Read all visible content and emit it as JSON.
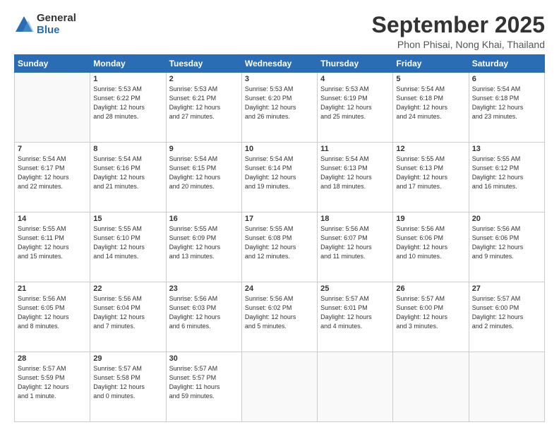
{
  "logo": {
    "text_general": "General",
    "text_blue": "Blue"
  },
  "header": {
    "month": "September 2025",
    "location": "Phon Phisai, Nong Khai, Thailand"
  },
  "days_of_week": [
    "Sunday",
    "Monday",
    "Tuesday",
    "Wednesday",
    "Thursday",
    "Friday",
    "Saturday"
  ],
  "weeks": [
    [
      {
        "num": "",
        "info": ""
      },
      {
        "num": "1",
        "info": "Sunrise: 5:53 AM\nSunset: 6:22 PM\nDaylight: 12 hours\nand 28 minutes."
      },
      {
        "num": "2",
        "info": "Sunrise: 5:53 AM\nSunset: 6:21 PM\nDaylight: 12 hours\nand 27 minutes."
      },
      {
        "num": "3",
        "info": "Sunrise: 5:53 AM\nSunset: 6:20 PM\nDaylight: 12 hours\nand 26 minutes."
      },
      {
        "num": "4",
        "info": "Sunrise: 5:53 AM\nSunset: 6:19 PM\nDaylight: 12 hours\nand 25 minutes."
      },
      {
        "num": "5",
        "info": "Sunrise: 5:54 AM\nSunset: 6:18 PM\nDaylight: 12 hours\nand 24 minutes."
      },
      {
        "num": "6",
        "info": "Sunrise: 5:54 AM\nSunset: 6:18 PM\nDaylight: 12 hours\nand 23 minutes."
      }
    ],
    [
      {
        "num": "7",
        "info": "Sunrise: 5:54 AM\nSunset: 6:17 PM\nDaylight: 12 hours\nand 22 minutes."
      },
      {
        "num": "8",
        "info": "Sunrise: 5:54 AM\nSunset: 6:16 PM\nDaylight: 12 hours\nand 21 minutes."
      },
      {
        "num": "9",
        "info": "Sunrise: 5:54 AM\nSunset: 6:15 PM\nDaylight: 12 hours\nand 20 minutes."
      },
      {
        "num": "10",
        "info": "Sunrise: 5:54 AM\nSunset: 6:14 PM\nDaylight: 12 hours\nand 19 minutes."
      },
      {
        "num": "11",
        "info": "Sunrise: 5:54 AM\nSunset: 6:13 PM\nDaylight: 12 hours\nand 18 minutes."
      },
      {
        "num": "12",
        "info": "Sunrise: 5:55 AM\nSunset: 6:13 PM\nDaylight: 12 hours\nand 17 minutes."
      },
      {
        "num": "13",
        "info": "Sunrise: 5:55 AM\nSunset: 6:12 PM\nDaylight: 12 hours\nand 16 minutes."
      }
    ],
    [
      {
        "num": "14",
        "info": "Sunrise: 5:55 AM\nSunset: 6:11 PM\nDaylight: 12 hours\nand 15 minutes."
      },
      {
        "num": "15",
        "info": "Sunrise: 5:55 AM\nSunset: 6:10 PM\nDaylight: 12 hours\nand 14 minutes."
      },
      {
        "num": "16",
        "info": "Sunrise: 5:55 AM\nSunset: 6:09 PM\nDaylight: 12 hours\nand 13 minutes."
      },
      {
        "num": "17",
        "info": "Sunrise: 5:55 AM\nSunset: 6:08 PM\nDaylight: 12 hours\nand 12 minutes."
      },
      {
        "num": "18",
        "info": "Sunrise: 5:56 AM\nSunset: 6:07 PM\nDaylight: 12 hours\nand 11 minutes."
      },
      {
        "num": "19",
        "info": "Sunrise: 5:56 AM\nSunset: 6:06 PM\nDaylight: 12 hours\nand 10 minutes."
      },
      {
        "num": "20",
        "info": "Sunrise: 5:56 AM\nSunset: 6:06 PM\nDaylight: 12 hours\nand 9 minutes."
      }
    ],
    [
      {
        "num": "21",
        "info": "Sunrise: 5:56 AM\nSunset: 6:05 PM\nDaylight: 12 hours\nand 8 minutes."
      },
      {
        "num": "22",
        "info": "Sunrise: 5:56 AM\nSunset: 6:04 PM\nDaylight: 12 hours\nand 7 minutes."
      },
      {
        "num": "23",
        "info": "Sunrise: 5:56 AM\nSunset: 6:03 PM\nDaylight: 12 hours\nand 6 minutes."
      },
      {
        "num": "24",
        "info": "Sunrise: 5:56 AM\nSunset: 6:02 PM\nDaylight: 12 hours\nand 5 minutes."
      },
      {
        "num": "25",
        "info": "Sunrise: 5:57 AM\nSunset: 6:01 PM\nDaylight: 12 hours\nand 4 minutes."
      },
      {
        "num": "26",
        "info": "Sunrise: 5:57 AM\nSunset: 6:00 PM\nDaylight: 12 hours\nand 3 minutes."
      },
      {
        "num": "27",
        "info": "Sunrise: 5:57 AM\nSunset: 6:00 PM\nDaylight: 12 hours\nand 2 minutes."
      }
    ],
    [
      {
        "num": "28",
        "info": "Sunrise: 5:57 AM\nSunset: 5:59 PM\nDaylight: 12 hours\nand 1 minute."
      },
      {
        "num": "29",
        "info": "Sunrise: 5:57 AM\nSunset: 5:58 PM\nDaylight: 12 hours\nand 0 minutes."
      },
      {
        "num": "30",
        "info": "Sunrise: 5:57 AM\nSunset: 5:57 PM\nDaylight: 11 hours\nand 59 minutes."
      },
      {
        "num": "",
        "info": ""
      },
      {
        "num": "",
        "info": ""
      },
      {
        "num": "",
        "info": ""
      },
      {
        "num": "",
        "info": ""
      }
    ]
  ]
}
